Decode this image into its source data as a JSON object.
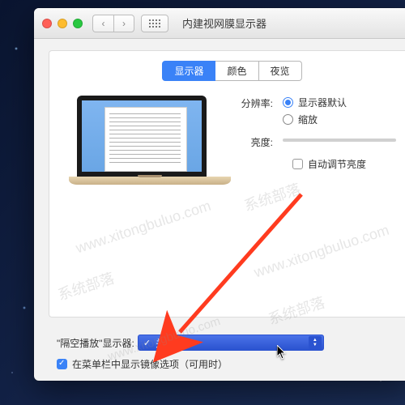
{
  "window": {
    "title": "内建视网膜显示器"
  },
  "tabs": {
    "display": "显示器",
    "color": "颜色",
    "night": "夜览"
  },
  "settings": {
    "resolution_label": "分辨率:",
    "resolution_default": "显示器默认",
    "resolution_scaled": "缩放",
    "brightness_label": "亮度:",
    "auto_brightness": "自动调节亮度"
  },
  "airplay": {
    "label": "\"隔空播放\"显示器:",
    "selected": "关闭"
  },
  "mirror": {
    "label": "在菜单栏中显示镜像选项（可用时）"
  },
  "watermark": {
    "text1": "系统部落",
    "text2": "www.xitongbuluo.com"
  }
}
